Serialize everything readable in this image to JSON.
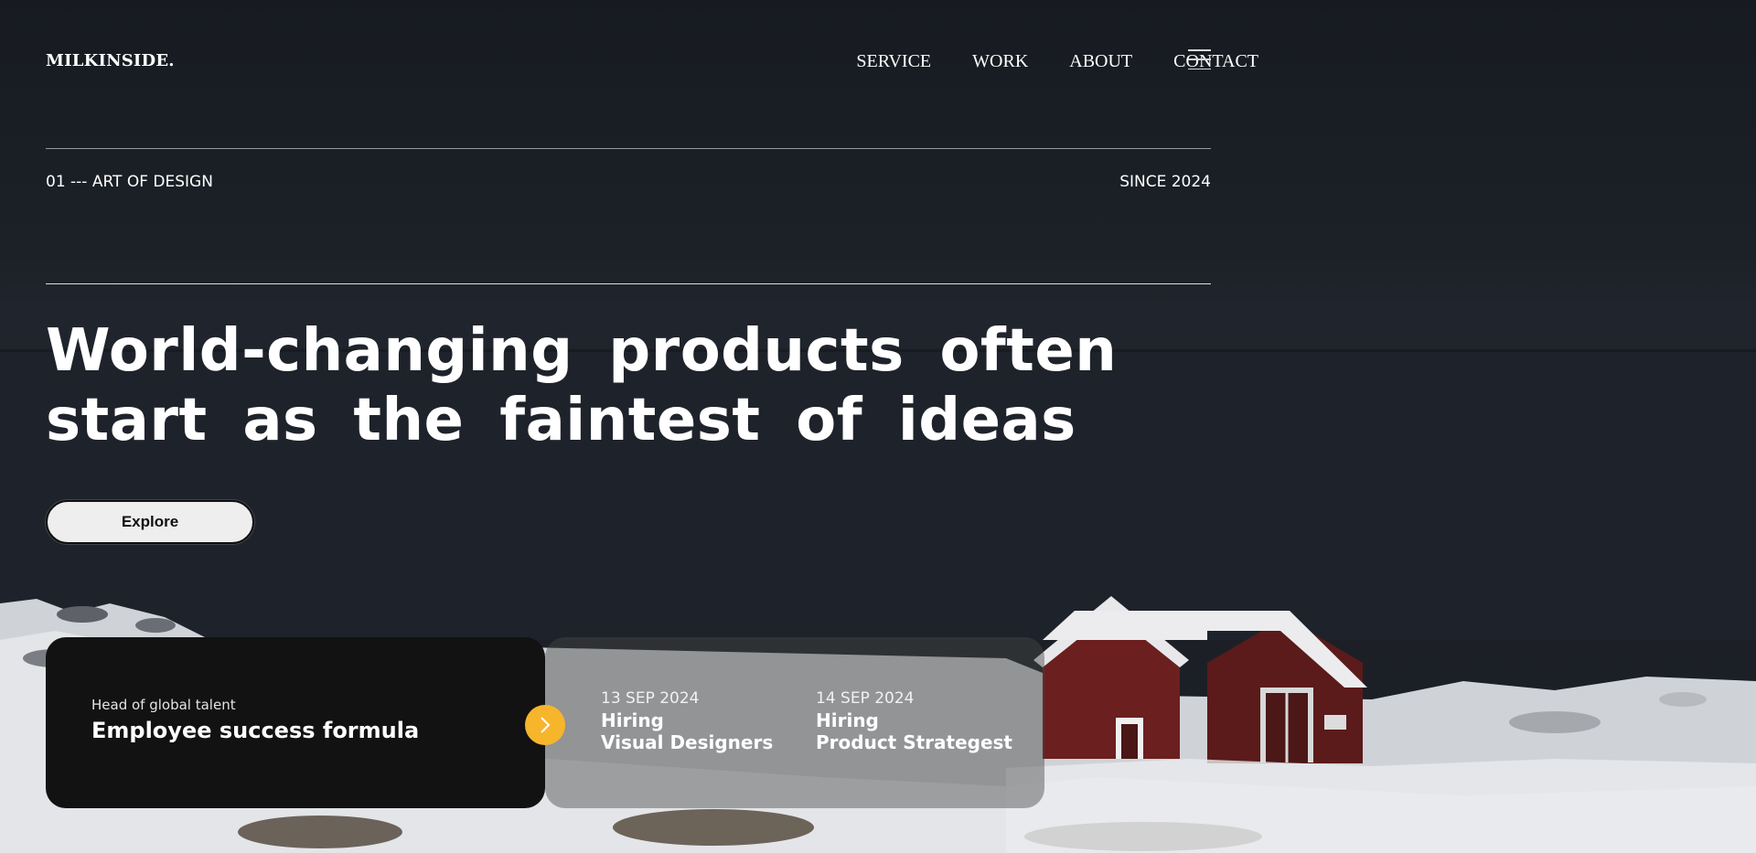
{
  "brand": {
    "logo": "MILKINSIDE."
  },
  "nav": {
    "items": [
      "SERVICE",
      "WORK",
      "ABOUT",
      "CONTACT"
    ],
    "menu_icon": "hamburger-menu-icon"
  },
  "meta": {
    "left": "01 --- ART OF DESIGN",
    "right": "SINCE 2024"
  },
  "hero": {
    "headline_line1": "World-changing products often",
    "headline_line2": "start as the faintest of ideas",
    "cta_label": "Explore"
  },
  "featured_card": {
    "subtitle": "Head of global talent",
    "title": "Employee success formula",
    "arrow_icon": "chevron-right-icon"
  },
  "jobs": [
    {
      "date": "13 SEP 2024",
      "type": "Hiring",
      "role": "Visual Designers"
    },
    {
      "date": "14 SEP 2024",
      "type": "Hiring",
      "role": "Product Strategest"
    }
  ],
  "colors": {
    "accent": "#f7b52c",
    "card_dark": "#121212",
    "text": "#ffffff"
  }
}
